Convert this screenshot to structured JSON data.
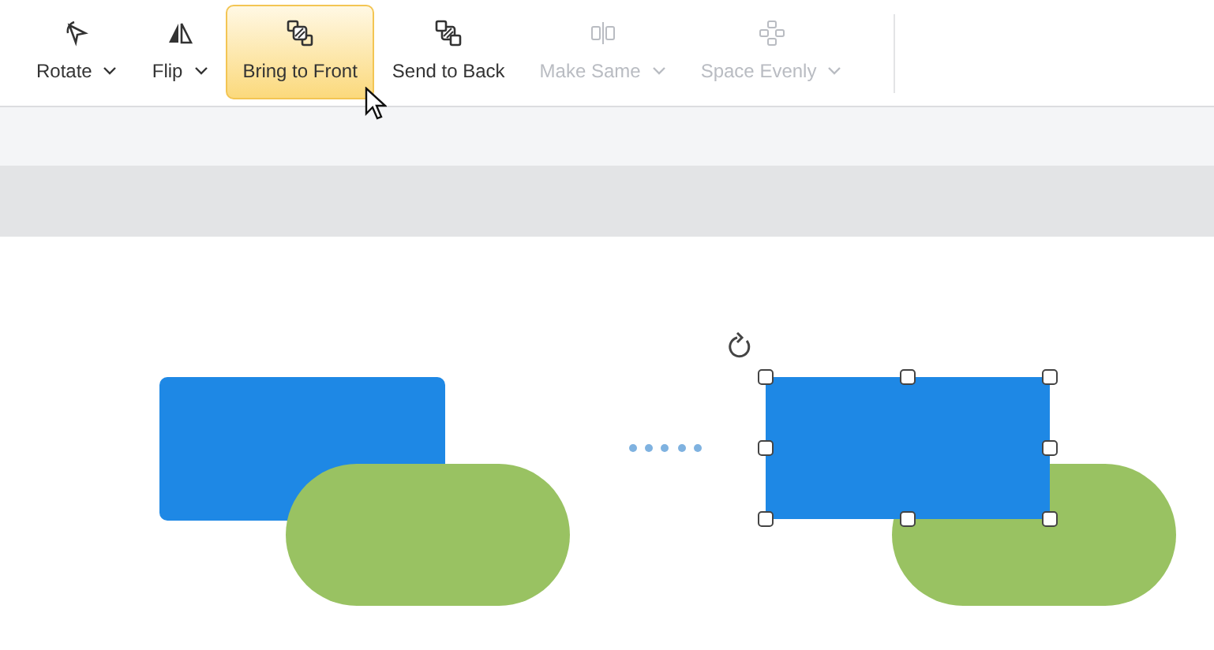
{
  "toolbar": [
    {
      "kind": "rotate",
      "label": "Rotate",
      "dropdown": true,
      "disabled": false,
      "selected": false
    },
    {
      "kind": "flip",
      "label": "Flip",
      "dropdown": true,
      "disabled": false,
      "selected": false
    },
    {
      "kind": "front",
      "label": "Bring to Front",
      "dropdown": false,
      "disabled": false,
      "selected": true
    },
    {
      "kind": "back",
      "label": "Send to Back",
      "dropdown": false,
      "disabled": false,
      "selected": false
    },
    {
      "kind": "same",
      "label": "Make Same",
      "dropdown": true,
      "disabled": true,
      "selected": false
    },
    {
      "kind": "space",
      "label": "Space Evenly",
      "dropdown": true,
      "disabled": true,
      "selected": false
    }
  ]
}
